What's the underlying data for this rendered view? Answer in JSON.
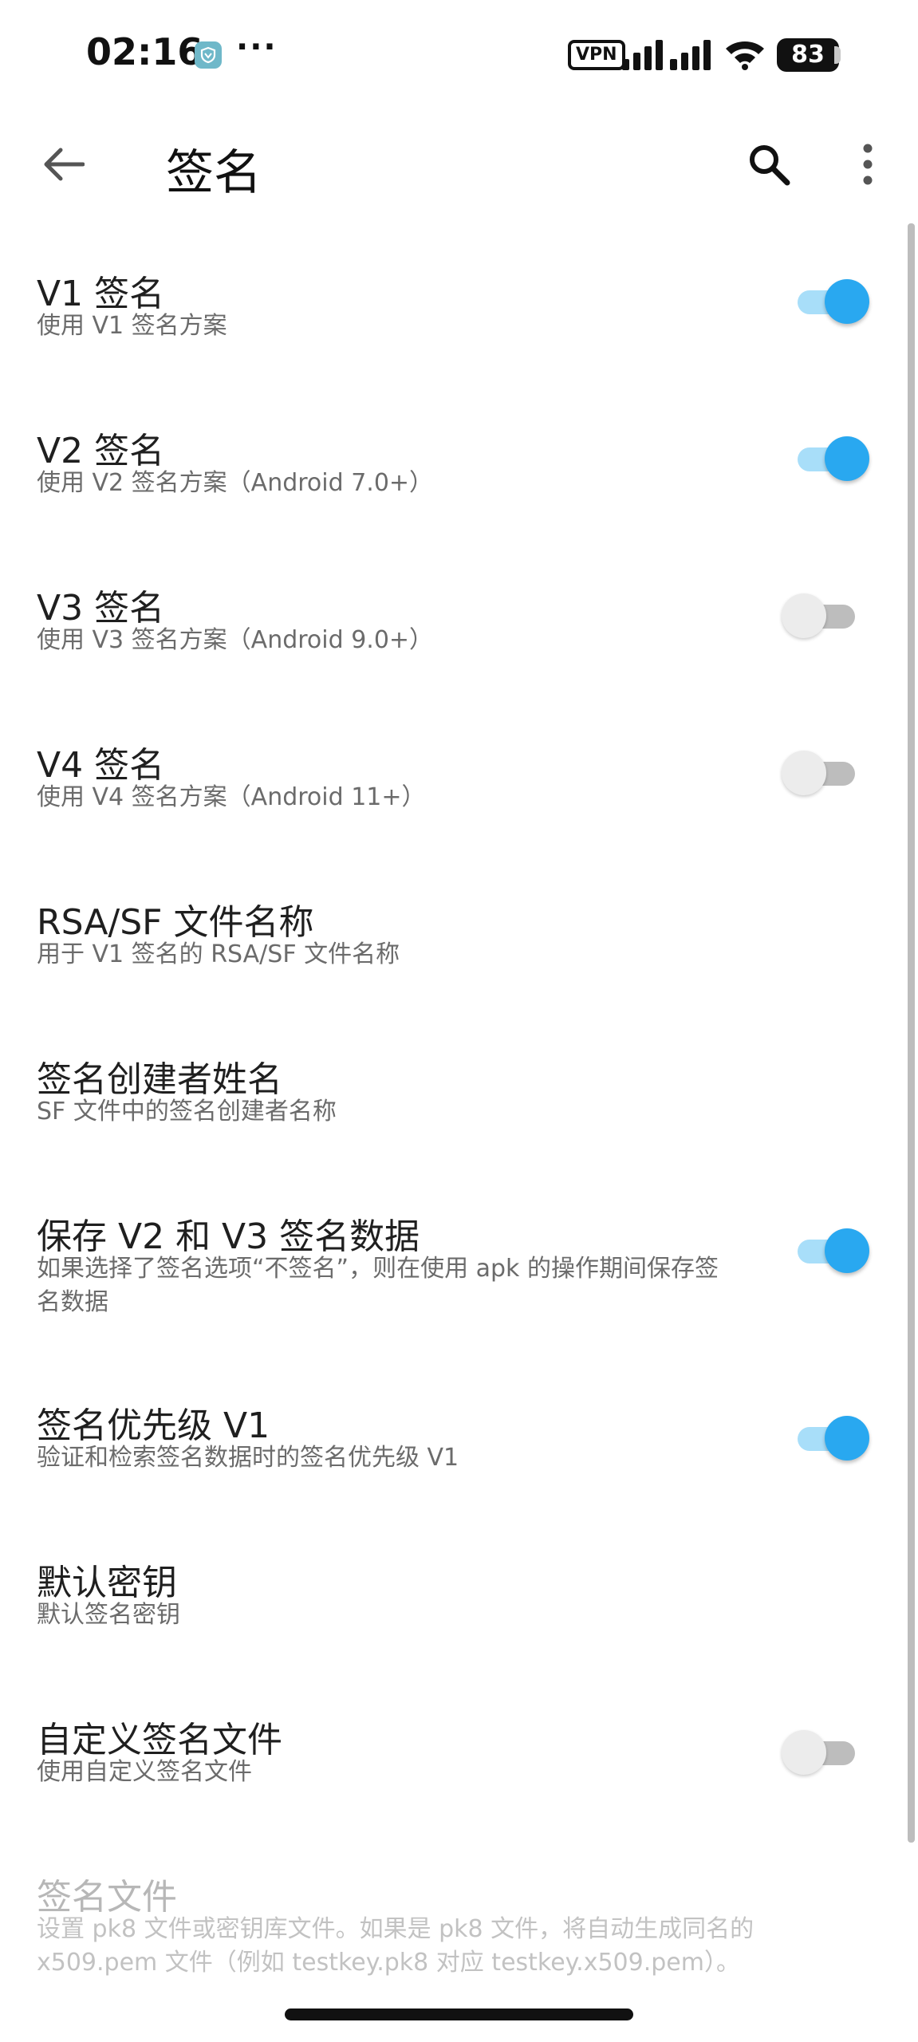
{
  "status_bar": {
    "time": "02:16",
    "more_dots": "···",
    "vpn_label": "VPN",
    "battery_level": "83"
  },
  "app_bar": {
    "title": "签名"
  },
  "settings": [
    {
      "id": "v1",
      "title": "V1 签名",
      "summary": "使用 V1 签名方案",
      "switch": true,
      "checked": true,
      "enabled": true
    },
    {
      "id": "v2",
      "title": "V2 签名",
      "summary": "使用 V2 签名方案（Android 7.0+）",
      "switch": true,
      "checked": true,
      "enabled": true
    },
    {
      "id": "v3",
      "title": "V3 签名",
      "summary": "使用 V3 签名方案（Android 9.0+）",
      "switch": true,
      "checked": false,
      "enabled": true
    },
    {
      "id": "v4",
      "title": "V4 签名",
      "summary": "使用 V4 签名方案（Android 11+）",
      "switch": true,
      "checked": false,
      "enabled": true
    },
    {
      "id": "rsa-sf",
      "title": "RSA/SF 文件名称",
      "summary": "用于 V1 签名的 RSA/SF 文件名称",
      "switch": false,
      "enabled": true
    },
    {
      "id": "creator",
      "title": "签名创建者姓名",
      "summary": "SF 文件中的签名创建者名称",
      "switch": false,
      "enabled": true
    },
    {
      "id": "save-v2v3",
      "title": "保存 V2 和 V3 签名数据",
      "summary": "如果选择了签名选项“不签名”，则在使用 apk 的操作期间保存签名数据",
      "switch": true,
      "checked": true,
      "enabled": true
    },
    {
      "id": "priority-v1",
      "title": "签名优先级 V1",
      "summary": "验证和检索签名数据时的签名优先级 V1",
      "switch": true,
      "checked": true,
      "enabled": true
    },
    {
      "id": "default-key",
      "title": "默认密钥",
      "summary": "默认签名密钥",
      "switch": false,
      "enabled": true
    },
    {
      "id": "custom-file",
      "title": "自定义签名文件",
      "summary": "使用自定义签名文件",
      "switch": true,
      "checked": false,
      "enabled": true
    },
    {
      "id": "sign-file",
      "title": "签名文件",
      "summary": "设置 pk8 文件或密钥库文件。如果是 pk8 文件，将自动生成同名的 x509.pem 文件（例如 testkey.pk8 对应 testkey.x509.pem）。",
      "switch": false,
      "enabled": false
    }
  ],
  "colors": {
    "switch_on_thumb": "#29a8f0",
    "switch_on_track": "#a8def9",
    "switch_off_thumb": "#ececec",
    "switch_off_track": "#bdbdbd"
  }
}
